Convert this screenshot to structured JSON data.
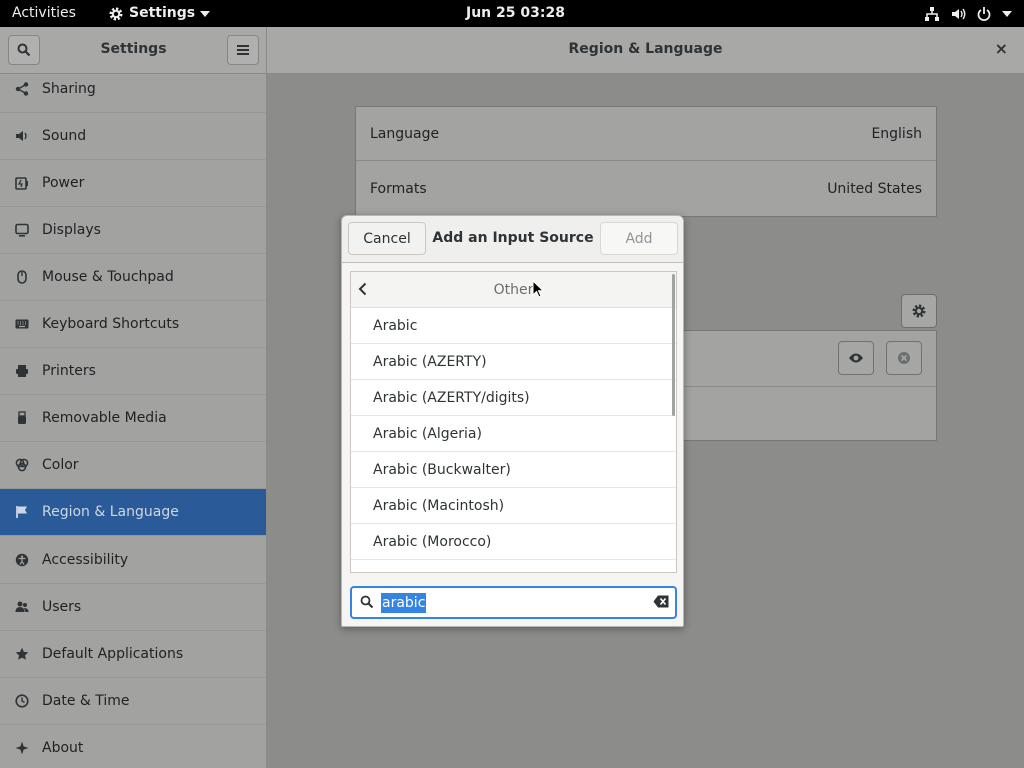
{
  "topbar": {
    "activities": "Activities",
    "app_name": "Settings",
    "clock": "Jun 25  03:28"
  },
  "header": {
    "sidebar_title": "Settings",
    "page_title": "Region & Language",
    "close": "×"
  },
  "sidebar": {
    "items": [
      {
        "label": "Sharing",
        "icon": "share-icon"
      },
      {
        "label": "Sound",
        "icon": "speaker-icon"
      },
      {
        "label": "Power",
        "icon": "power-icon"
      },
      {
        "label": "Displays",
        "icon": "display-icon"
      },
      {
        "label": "Mouse & Touchpad",
        "icon": "mouse-icon"
      },
      {
        "label": "Keyboard Shortcuts",
        "icon": "keyboard-icon"
      },
      {
        "label": "Printers",
        "icon": "printer-icon"
      },
      {
        "label": "Removable Media",
        "icon": "usb-icon"
      },
      {
        "label": "Color",
        "icon": "color-icon"
      },
      {
        "label": "Region & Language",
        "icon": "flag-icon",
        "active": true
      },
      {
        "label": "Accessibility",
        "icon": "accessibility-icon"
      },
      {
        "label": "Users",
        "icon": "users-icon"
      },
      {
        "label": "Default Applications",
        "icon": "star-icon"
      },
      {
        "label": "Date & Time",
        "icon": "clock-icon"
      },
      {
        "label": "About",
        "icon": "about-icon"
      }
    ]
  },
  "region": {
    "language_label": "Language",
    "language_value": "English",
    "formats_label": "Formats",
    "formats_value": "United States"
  },
  "dialog": {
    "cancel": "Cancel",
    "title": "Add an Input Source",
    "add": "Add",
    "list_title": "Other",
    "items": [
      "Arabic",
      "Arabic (AZERTY)",
      "Arabic (AZERTY/digits)",
      "Arabic (Algeria)",
      "Arabic (Buckwalter)",
      "Arabic (Macintosh)",
      "Arabic (Morocco)"
    ],
    "search_value": "arabic"
  },
  "colors": {
    "accent": "#3584e4",
    "sidebar_active": "#2a5a97"
  }
}
